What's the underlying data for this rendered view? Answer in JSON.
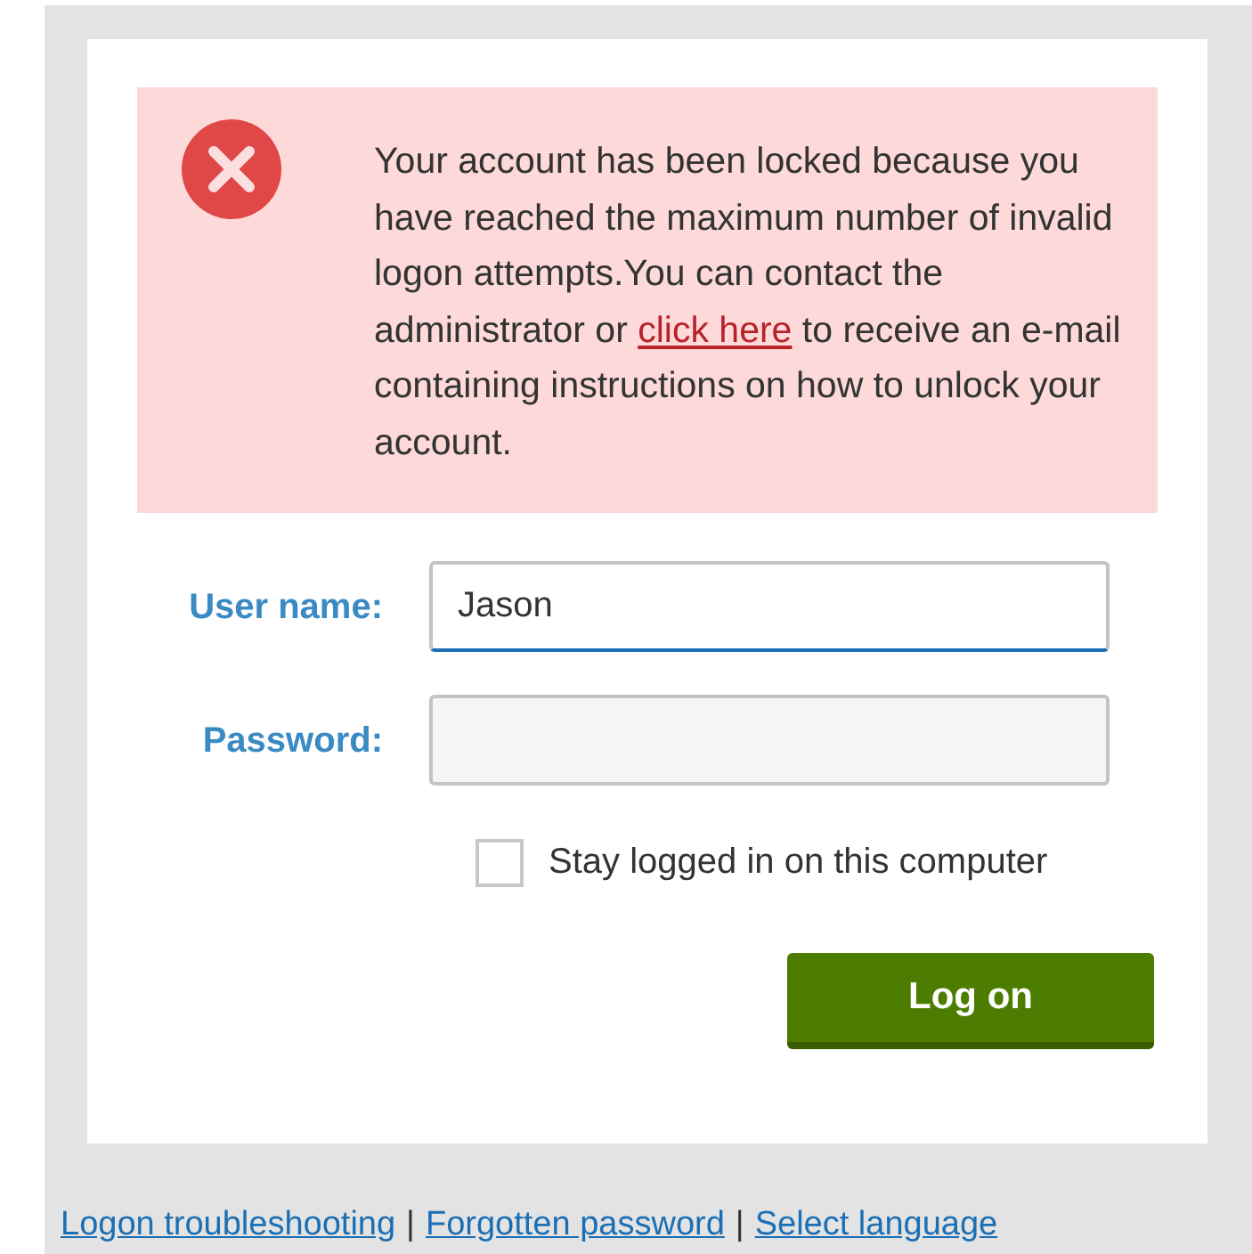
{
  "alert": {
    "text_before": "Your account has been locked because you have reached the maximum number of invalid logon attempts.You can contact the administrator or",
    "link": "click here",
    "text_after": "to receive an e-mail containing instructions on how to unlock your account."
  },
  "fields": [
    {
      "label": "User name:",
      "value": "Jason",
      "focused": true
    },
    {
      "label": "Password:",
      "focused": false
    }
  ],
  "stay_logged_in": {
    "label": "Stay logged in on this computer",
    "checked": false
  },
  "button": "Log on",
  "footer": [
    {
      "kind": "link",
      "text": "Logon troubleshooting"
    },
    {
      "kind": "separator",
      "text": "|"
    },
    {
      "kind": "link",
      "text": "Forgotten password"
    },
    {
      "kind": "separator",
      "text": "|"
    },
    {
      "kind": "link",
      "text": "Select language"
    }
  ]
}
